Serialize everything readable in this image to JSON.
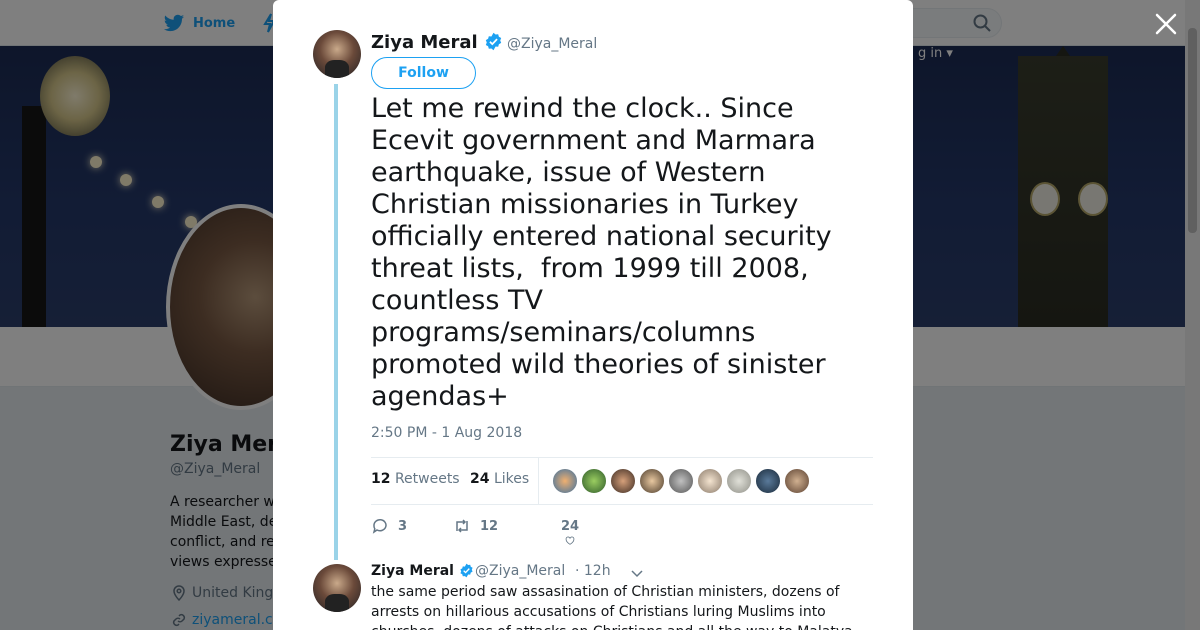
{
  "nav": {
    "home_label": "Home",
    "login_text": "g in ▾"
  },
  "profile": {
    "name": "Ziya Meral",
    "handle": "@Ziya_Meral",
    "bio_lines": [
      "A researcher w",
      "Middle East, de",
      "conflict, and re",
      "views expresse"
    ],
    "location": "United King",
    "url": "ziyameral.c"
  },
  "tweet": {
    "author_name": "Ziya Meral",
    "author_handle": "@Ziya_Meral",
    "follow_label": "Follow",
    "text": "Let me rewind the clock.. Since Ecevit government and Marmara earthquake, issue of Western Christian missionaries in Turkey officially entered national security threat lists,  from 1999 till 2008, countless TV programs/seminars/columns promoted wild theories of sinister agendas+",
    "timestamp": "2:50 PM - 1 Aug 2018",
    "retweets_count": "12",
    "retweets_label": "Retweets",
    "likes_count": "24",
    "likes_label": "Likes",
    "reply_count": "3",
    "retweet_action_count": "12",
    "like_action_count": "24"
  },
  "reply": {
    "author_name": "Ziya Meral",
    "author_handle": "@Ziya_Meral",
    "time": "· 12h",
    "text": "the same period saw assasination of Christian ministers, dozens of arrests on hillarious accusations of Christians luring Muslims into churches, dozens of attacks on Christians and all the way to Malatya"
  },
  "colors": {
    "accent": "#1da1f2",
    "thread_line": "#9ad3e8",
    "muted": "#657786"
  },
  "icons": [
    "twitter-bird-icon",
    "search-icon",
    "close-icon",
    "verified-icon",
    "reply-icon",
    "retweet-icon",
    "heart-icon",
    "chevron-down-icon",
    "location-icon",
    "link-icon"
  ]
}
